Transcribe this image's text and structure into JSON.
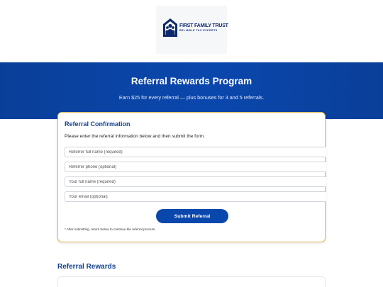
{
  "brand": {
    "logo_name": "FIRST FAMILY TRUST",
    "logo_tagline": "RELIABLE TAX EXPERTS",
    "logo_icon": "house-family-icon",
    "color_primary": "#0a47ad",
    "color_accent": "#d9b75b"
  },
  "hero": {
    "title": "Referral Rewards Program",
    "subtitle": "Earn $25 for every referral — plus bonuses for 3 and 5 referrals."
  },
  "form": {
    "title": "Referral Confirmation",
    "intro": "Please enter the referral information below and then submit the form.",
    "fields": [
      {
        "placeholder": "Referrer full name (required)",
        "value": ""
      },
      {
        "placeholder": "Referrer phone (optional)",
        "value": ""
      },
      {
        "placeholder": "Your full name (required)",
        "value": ""
      },
      {
        "placeholder": "Your email (optional)",
        "value": ""
      }
    ],
    "submit_label": "Submit Referral",
    "note": "* After submitting, return below to continue the referral process."
  },
  "rewards": {
    "title": "Referral Rewards"
  }
}
